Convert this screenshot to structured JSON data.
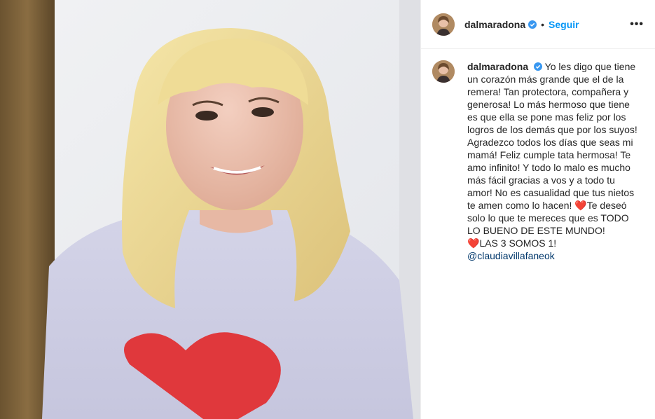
{
  "post": {
    "username": "dalmaradona",
    "separator": "•",
    "follow_label": "Seguir",
    "more_label": "•••",
    "caption": {
      "text_1": "Yo les digo que tiene un corazón más grande que el de la remera! Tan protectora, compañera y generosa! Lo más hermoso que tiene es que ella se pone mas feliz por los logros de los demás que por los suyos! Agradezco todos los días que seas mi mamá! Feliz cumple tata hermosa! Te amo infinito! Y todo lo malo es mucho más fácil gracias a vos y a todo tu amor! No es casualidad que tus nietos te amen como lo hacen! ",
      "heart_1": "❤️",
      "text_2": "Te deseó solo lo que te mereces que es TODO LO BUENO DE ESTE MUNDO! ",
      "heart_2": "❤️",
      "text_3": "LAS 3 SOMOS 1!",
      "mention": "@claudiavillafaneok"
    }
  },
  "colors": {
    "follow": "#0095f6",
    "mention": "#00376b",
    "verified": "#3897f0",
    "heart": "#ed4956"
  }
}
